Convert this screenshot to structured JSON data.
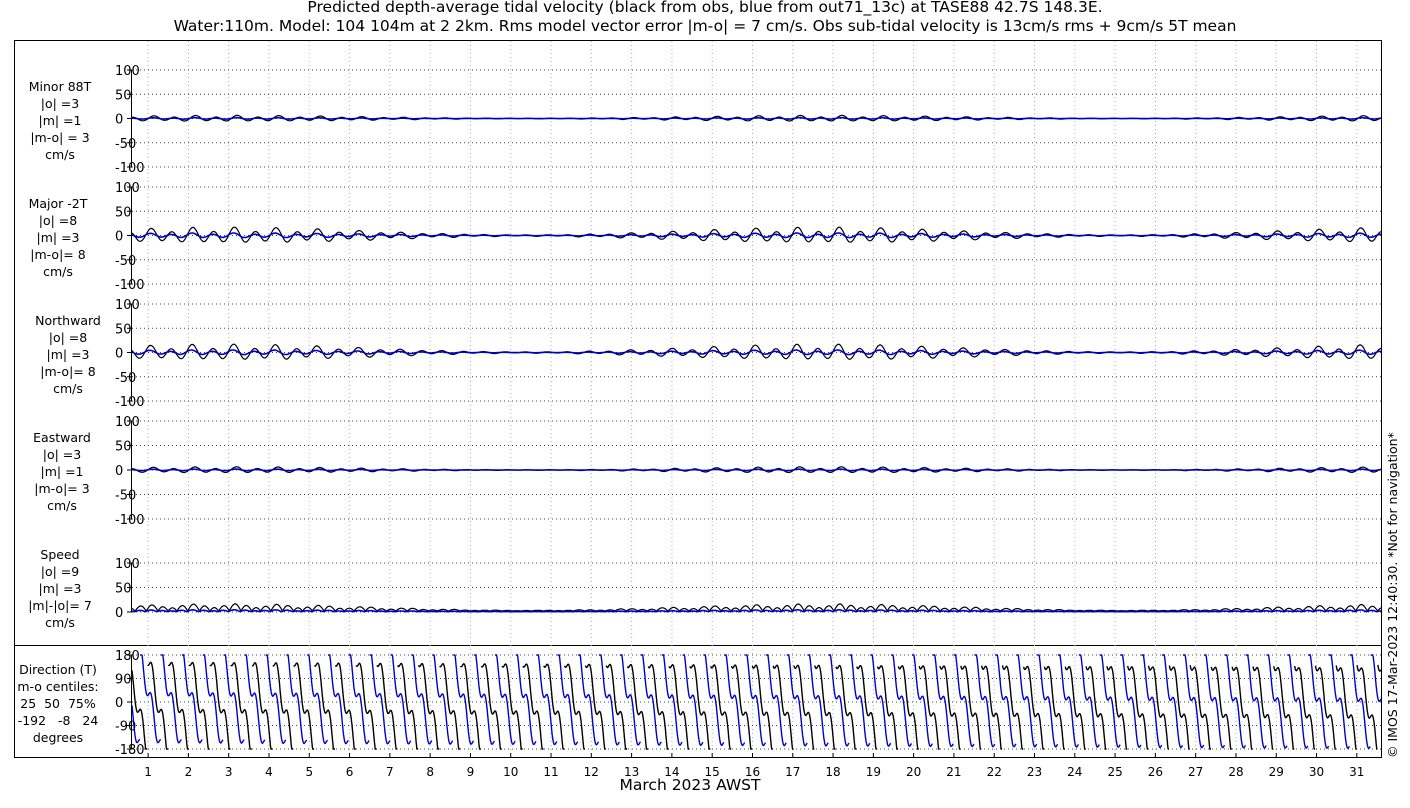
{
  "title_line1": "Predicted depth-average tidal velocity (black from obs, blue from out71_13c) at TASE88 42.7S 148.3E.",
  "title_line2": "Water:110m. Model: 104 104m at 2 2km. Rms model vector error |m-o| = 7 cm/s. Obs sub-tidal velocity is 13cm/s rms + 9cm/s 5T mean",
  "xlabel": "March 2023 AWST",
  "credit": "© IMOS 17-Mar-2023 12:40:30. *Not for navigation*",
  "day_ticks": [
    "1",
    "2",
    "3",
    "4",
    "5",
    "6",
    "7",
    "8",
    "9",
    "10",
    "11",
    "12",
    "13",
    "14",
    "15",
    "16",
    "17",
    "18",
    "19",
    "20",
    "21",
    "22",
    "23",
    "24",
    "25",
    "26",
    "27",
    "28",
    "29",
    "30",
    "31"
  ],
  "colors": {
    "obs": "#000000",
    "model": "#0000cc",
    "grid": "#b0b0b0"
  },
  "panels": [
    {
      "id": "minor",
      "label_lines": [
        "Minor 88T",
        "|o| =3",
        "|m| =1",
        "|m-o| = 3",
        "cm/s"
      ],
      "yticks": [
        "100",
        "50",
        "0",
        "-50",
        "-100"
      ],
      "ylim": [
        -100,
        100
      ],
      "obs_amp": 3,
      "model_amp": 1,
      "offset": 0,
      "kind": "velocity"
    },
    {
      "id": "major",
      "label_lines": [
        "Major -2T",
        "|o| =8",
        "|m| =3",
        "|m-o|= 8",
        "cm/s"
      ],
      "yticks": [
        "100",
        "50",
        "0",
        "-50",
        "-100"
      ],
      "ylim": [
        -100,
        100
      ],
      "obs_amp": 8,
      "model_amp": 3,
      "offset": 0,
      "kind": "velocity"
    },
    {
      "id": "northward",
      "label_lines": [
        "Northward",
        "|o| =8",
        "|m| =3",
        "|m-o|= 8",
        "cm/s"
      ],
      "yticks": [
        "100",
        "50",
        "0",
        "-50",
        "-100"
      ],
      "ylim": [
        -100,
        100
      ],
      "obs_amp": 8,
      "model_amp": 3,
      "offset": 0,
      "kind": "velocity"
    },
    {
      "id": "eastward",
      "label_lines": [
        "Eastward",
        "|o| =3",
        "|m| =1",
        "|m-o|= 3",
        "cm/s"
      ],
      "yticks": [
        "100",
        "50",
        "0",
        "-50",
        "-100"
      ],
      "ylim": [
        -100,
        100
      ],
      "obs_amp": 3,
      "model_amp": 1,
      "offset": 0,
      "kind": "velocity"
    },
    {
      "id": "speed",
      "label_lines": [
        "Speed",
        "|o| =9",
        "|m| =3",
        "|m|-|o|= 7",
        "cm/s"
      ],
      "yticks": [
        "100",
        "50",
        "0"
      ],
      "ylim": [
        0,
        100
      ],
      "obs_amp": 9,
      "model_amp": 3,
      "offset": 0,
      "kind": "speed"
    },
    {
      "id": "direction",
      "label_lines": [
        "Direction (T)",
        "m-o centiles:",
        "25  50  75%",
        "-192   -8   24",
        "degrees"
      ],
      "yticks": [
        "180",
        "90",
        "0",
        "-90",
        "-180"
      ],
      "ylim": [
        -180,
        180
      ],
      "kind": "direction"
    }
  ],
  "chart_data": {
    "type": "line",
    "title": "Predicted depth-average tidal velocity (black from obs, blue from out71_13c) at TASE88 42.7S 148.3E.",
    "xlabel": "March 2023 AWST",
    "x_days": [
      1,
      31
    ],
    "series": [
      {
        "name": "obs",
        "stats": {
          "minor_rms": 3,
          "major_rms": 8,
          "north_rms": 8,
          "east_rms": 3,
          "speed_mean": 9
        }
      },
      {
        "name": "out71_13c",
        "stats": {
          "minor_rms": 1,
          "major_rms": 3,
          "north_rms": 3,
          "east_rms": 1,
          "speed_mean": 3
        }
      }
    ],
    "direction_centiles_m_minus_o": {
      "p25": -192,
      "p50": -8,
      "p75": 24
    }
  }
}
